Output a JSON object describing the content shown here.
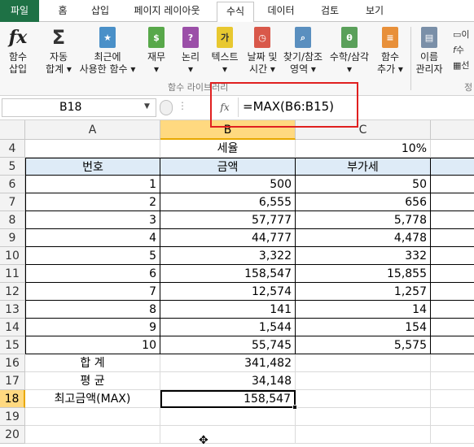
{
  "ribbon_tabs": [
    {
      "label": "파일"
    },
    {
      "label": "홈"
    },
    {
      "label": "삽입"
    },
    {
      "label": "페이지 레이아웃"
    },
    {
      "label": "수식"
    },
    {
      "label": "데이터"
    },
    {
      "label": "검토"
    },
    {
      "label": "보기"
    }
  ],
  "active_tab": "수식",
  "ribbon": {
    "insert_function": {
      "line1": "함수",
      "line2": "삽입"
    },
    "autosum": {
      "line1": "자동",
      "line2": "합계 ▾"
    },
    "recent": {
      "line1": "최근에",
      "line2": "사용한 함수 ▾"
    },
    "financial": {
      "line1": "재무",
      "line2": "▾"
    },
    "logical": {
      "line1": "논리",
      "line2": "▾"
    },
    "text": {
      "line1": "텍스트",
      "line2": "▾"
    },
    "datetime": {
      "line1": "날짜 및",
      "line2": "시간 ▾"
    },
    "lookup": {
      "line1": "찾기/참조",
      "line2": "영역 ▾"
    },
    "math": {
      "line1": "수학/삼각",
      "line2": "▾"
    },
    "more": {
      "line1": "함수",
      "line2": "추가 ▾"
    },
    "name_manager": {
      "line1": "이름",
      "line2": "관리자"
    },
    "group_label": "함수 라이브러리",
    "right_items": [
      "이",
      "수",
      "선"
    ],
    "right_group_label": "정"
  },
  "formula_bar": {
    "name_box": "B18",
    "fx_label": "fx",
    "formula": "=MAX(B6:B15)"
  },
  "columns": [
    "A",
    "B",
    "C"
  ],
  "selected_column": "B",
  "selected_row": "18",
  "rows": [
    {
      "num": "4",
      "a": "",
      "b": "세율",
      "c": "10%"
    },
    {
      "num": "5",
      "a": "번호",
      "b": "금액",
      "c": "부가세"
    },
    {
      "num": "6",
      "a": "1",
      "b": "500",
      "c": "50"
    },
    {
      "num": "7",
      "a": "2",
      "b": "6,555",
      "c": "656"
    },
    {
      "num": "8",
      "a": "3",
      "b": "57,777",
      "c": "5,778"
    },
    {
      "num": "9",
      "a": "4",
      "b": "44,777",
      "c": "4,478"
    },
    {
      "num": "10",
      "a": "5",
      "b": "3,322",
      "c": "332"
    },
    {
      "num": "11",
      "a": "6",
      "b": "158,547",
      "c": "15,855"
    },
    {
      "num": "12",
      "a": "7",
      "b": "12,574",
      "c": "1,257"
    },
    {
      "num": "13",
      "a": "8",
      "b": "141",
      "c": "14"
    },
    {
      "num": "14",
      "a": "9",
      "b": "1,544",
      "c": "154"
    },
    {
      "num": "15",
      "a": "10",
      "b": "55,745",
      "c": "5,575"
    },
    {
      "num": "16",
      "a": "합 계",
      "b": "341,482",
      "c": ""
    },
    {
      "num": "17",
      "a": "평 균",
      "b": "34,148",
      "c": ""
    },
    {
      "num": "18",
      "a": "최고금액(MAX)",
      "b": "158,547",
      "c": ""
    },
    {
      "num": "19",
      "a": "",
      "b": "",
      "c": ""
    },
    {
      "num": "20",
      "a": "",
      "b": "",
      "c": ""
    }
  ],
  "colors": {
    "file_tab": "#1e7145",
    "header_fill": "#deebf7",
    "selection_header": "#ffd980",
    "annotation_box": "#e02020"
  }
}
